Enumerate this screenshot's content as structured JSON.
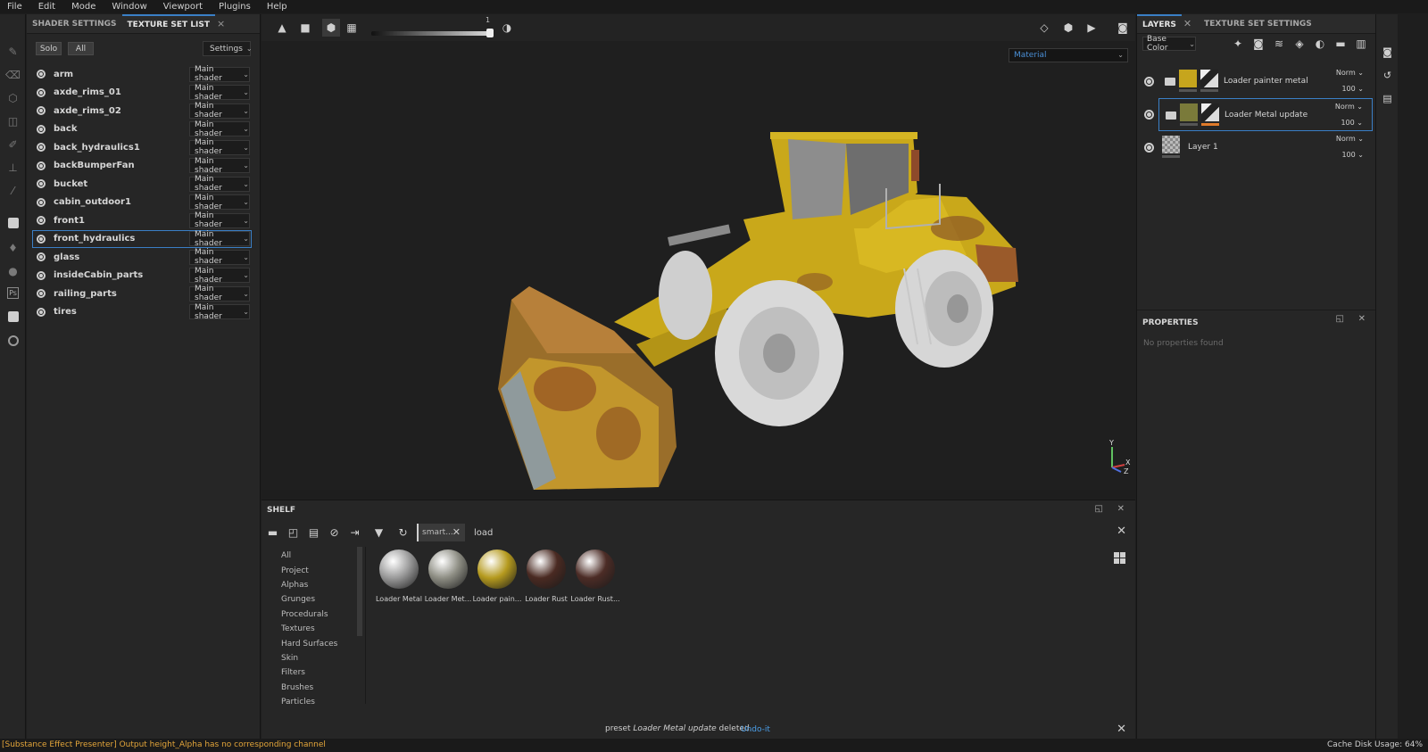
{
  "menu": [
    "File",
    "Edit",
    "Mode",
    "Window",
    "Viewport",
    "Plugins",
    "Help"
  ],
  "left_panel": {
    "tabs": [
      "SHADER SETTINGS",
      "TEXTURE SET LIST"
    ],
    "close_glyph": "×",
    "solo_label": "Solo",
    "all_label": "All",
    "settings_label": "Settings",
    "texture_sets": [
      {
        "name": "arm",
        "shader": "Main shader"
      },
      {
        "name": "axde_rims_01",
        "shader": "Main shader"
      },
      {
        "name": "axde_rims_02",
        "shader": "Main shader"
      },
      {
        "name": "back",
        "shader": "Main shader"
      },
      {
        "name": "back_hydraulics1",
        "shader": "Main shader"
      },
      {
        "name": "backBumperFan",
        "shader": "Main shader"
      },
      {
        "name": "bucket",
        "shader": "Main shader"
      },
      {
        "name": "cabin_outdoor1",
        "shader": "Main shader"
      },
      {
        "name": "front1",
        "shader": "Main shader"
      },
      {
        "name": "front_hydraulics",
        "shader": "Main shader"
      },
      {
        "name": "glass",
        "shader": "Main shader"
      },
      {
        "name": "insideCabin_parts",
        "shader": "Main shader"
      },
      {
        "name": "railing_parts",
        "shader": "Main shader"
      },
      {
        "name": "tires",
        "shader": "Main shader"
      }
    ]
  },
  "viewport": {
    "slider_value": "1",
    "slider_fraction": 0.97,
    "material_mode": "Material",
    "axis_labels": {
      "y": "Y",
      "x": "X",
      "z": "Z"
    }
  },
  "shelf": {
    "title": "SHELF",
    "filter_tag": "smart...",
    "search_value": "load",
    "categories": [
      "All",
      "Project",
      "Alphas",
      "Grunges",
      "Procedurals",
      "Textures",
      "Hard Surfaces",
      "Skin",
      "Filters",
      "Brushes",
      "Particles"
    ],
    "items": [
      {
        "label": "Loader Metal",
        "color": "#9a9a9a"
      },
      {
        "label": "Loader Met...",
        "color": "#8e8e84"
      },
      {
        "label": "Loader pain...",
        "color": "#b59a1e"
      },
      {
        "label": "Loader Rust",
        "color": "#4a2a22"
      },
      {
        "label": "Loader Rust...",
        "color": "#4c2c26"
      }
    ]
  },
  "notification": {
    "prefix": "preset",
    "preset_name": "Loader Metal update",
    "suffix": "deleted.",
    "undo": "Undo-it"
  },
  "right_panel": {
    "tabs": [
      "LAYERS",
      "TEXTURE SET SETTINGS"
    ],
    "channel": "Base Color",
    "layers": [
      {
        "name": "Loader painter metal",
        "blend": "Norm",
        "opacity": "100"
      },
      {
        "name": "Loader Metal update",
        "blend": "Norm",
        "opacity": "100"
      },
      {
        "name": "Layer 1",
        "blend": "Norm",
        "opacity": "100"
      }
    ],
    "properties_title": "PROPERTIES",
    "properties_empty": "No properties found"
  },
  "status": {
    "error": "[Substance Effect Presenter] Output height_Alpha has no corresponding channel",
    "cache": "Cache Disk Usage:  64%"
  },
  "colors": {
    "accent": "#3a7fc6",
    "warning": "#e3a53a",
    "link": "#4a9ee8",
    "loader_yellow": "#c9a81a"
  }
}
